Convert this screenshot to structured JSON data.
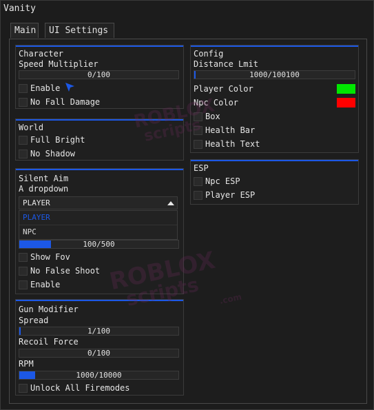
{
  "window": {
    "title": "Vanity"
  },
  "tabs": [
    {
      "label": "Main"
    },
    {
      "label": "UI Settings"
    }
  ],
  "character": {
    "header": "Character",
    "speed_label": "Speed Multiplier",
    "speed_value": "0/100",
    "speed_level": 0,
    "enable_label": "Enable",
    "no_fall_label": "No Fall Damage"
  },
  "config": {
    "header": "Config",
    "distance_label": "Distance Lmit",
    "distance_value": "1000/100100",
    "distance_level": 0.01,
    "player_color_label": "Player Color",
    "player_color": "#00e600",
    "npc_color_label": "Npc Color",
    "npc_color": "#ff0000",
    "box_label": "Box",
    "health_bar_label": "Health Bar",
    "health_text_label": "Health Text"
  },
  "world": {
    "header": "World",
    "full_bright_label": "Full Bright",
    "no_shadow_label": "No Shadow"
  },
  "esp": {
    "header": "ESP",
    "npc_esp_label": "Npc ESP",
    "player_esp_label": "Player ESP"
  },
  "silent_aim": {
    "header": "Silent Aim",
    "dropdown_label": "A dropdown",
    "selected": "PLAYER",
    "options": [
      "PLAYER",
      "NPC"
    ],
    "fov_value": "100/500",
    "fov_level": 0.2,
    "show_fov_label": "Show Fov",
    "no_false_label": "No False Shoot",
    "enable_label": "Enable"
  },
  "gun_modifier": {
    "header": "Gun Modifier",
    "spread_label": "Spread",
    "spread_value": "1/100",
    "spread_level": 0.01,
    "recoil_label": "Recoil Force",
    "recoil_value": "0/100",
    "recoil_level": 0,
    "rpm_label": "RPM",
    "rpm_value": "1000/10000",
    "rpm_level": 0.1,
    "unlock_label": "Unlock All Firemodes"
  },
  "watermark": {
    "line1": "ROBLOX",
    "line2": "scripts",
    "line3": ".com"
  },
  "colors": {
    "accent": "#1c58e6",
    "background": "#1c1c1c",
    "panel": "#1f1f1f"
  }
}
